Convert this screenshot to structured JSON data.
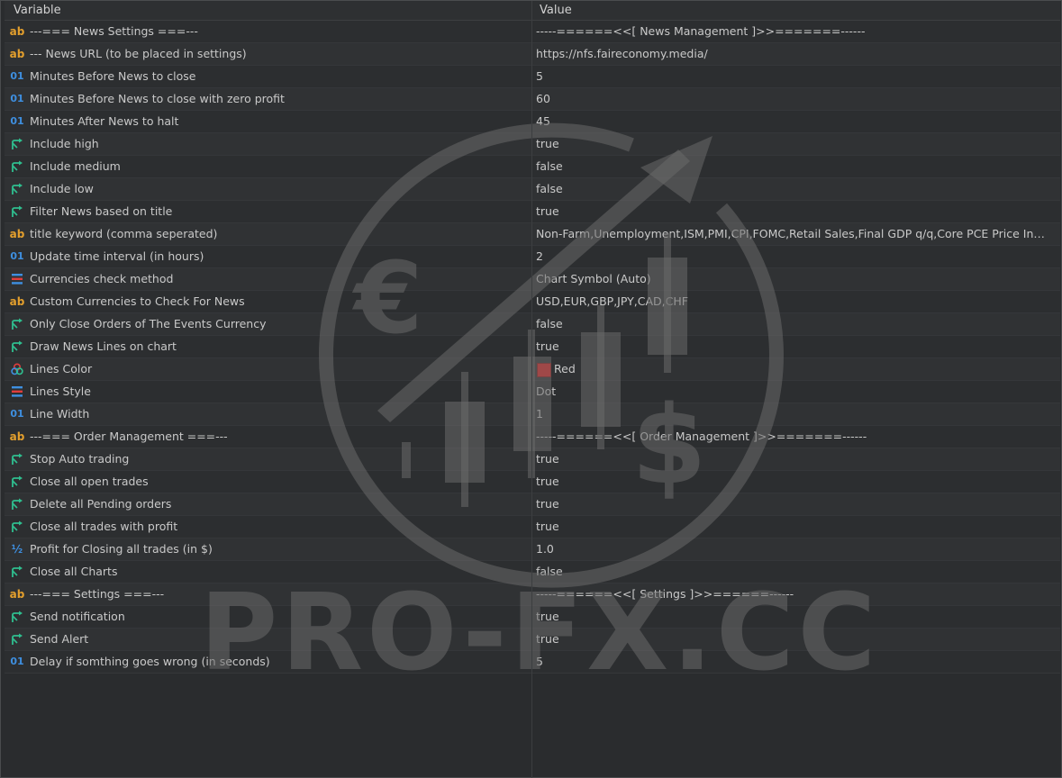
{
  "header": {
    "variable": "Variable",
    "value": "Value"
  },
  "rows": [
    {
      "icon": "ab",
      "variable": "---=== News Settings ===---",
      "value": "-----======<<[  News Management  ]>>=======------"
    },
    {
      "icon": "ab",
      "variable": "--- News URL (to be placed in settings)",
      "value": "https://nfs.faireconomy.media/"
    },
    {
      "icon": "01",
      "variable": "Minutes Before News to close",
      "value": "5"
    },
    {
      "icon": "01",
      "variable": "Minutes Before News to close with zero profit",
      "value": "60"
    },
    {
      "icon": "01",
      "variable": "Minutes After News to halt",
      "value": "45"
    },
    {
      "icon": "bool",
      "variable": "Include high",
      "value": "true"
    },
    {
      "icon": "bool",
      "variable": "Include medium",
      "value": "false"
    },
    {
      "icon": "bool",
      "variable": "Include low",
      "value": "false"
    },
    {
      "icon": "bool",
      "variable": "Filter News based on title",
      "value": "true"
    },
    {
      "icon": "ab",
      "variable": "title keyword (comma seperated)",
      "value": "Non-Farm,Unemployment,ISM,PMI,CPI,FOMC,Retail Sales,Final GDP q/q,Core PCE Price Index m/..."
    },
    {
      "icon": "01",
      "variable": "Update time interval (in hours)",
      "value": "2"
    },
    {
      "icon": "enum",
      "variable": "Currencies check method",
      "value": "Chart Symbol (Auto)"
    },
    {
      "icon": "ab",
      "variable": "Custom Currencies to Check For News",
      "value": "USD,EUR,GBP,JPY,CAD,CHF"
    },
    {
      "icon": "bool",
      "variable": "Only Close Orders of The Events Currency",
      "value": "false"
    },
    {
      "icon": "bool",
      "variable": "Draw News Lines on chart",
      "value": "true"
    },
    {
      "icon": "color",
      "variable": "Lines Color",
      "value": "Red",
      "swatch": "#e01f1f"
    },
    {
      "icon": "enum",
      "variable": "Lines Style",
      "value": "Dot"
    },
    {
      "icon": "01",
      "variable": "Line Width",
      "value": "1"
    },
    {
      "icon": "ab",
      "variable": "---=== Order Management ===---",
      "value": "-----======<<[  Order Management  ]>>=======------"
    },
    {
      "icon": "bool",
      "variable": "Stop Auto trading",
      "value": "true"
    },
    {
      "icon": "bool",
      "variable": "Close all open trades",
      "value": "true"
    },
    {
      "icon": "bool",
      "variable": "Delete all Pending orders",
      "value": "true"
    },
    {
      "icon": "bool",
      "variable": "Close all trades with profit",
      "value": "true"
    },
    {
      "icon": "frac",
      "variable": "Profit for Closing all trades (in $)",
      "value": "1.0"
    },
    {
      "icon": "bool",
      "variable": "Close all Charts",
      "value": "false"
    },
    {
      "icon": "ab",
      "variable": "---=== Settings ===---",
      "value": "-----======<<[  Settings  ]>>======------"
    },
    {
      "icon": "bool",
      "variable": "Send notification",
      "value": "true"
    },
    {
      "icon": "bool",
      "variable": "Send Alert",
      "value": "true"
    },
    {
      "icon": "01",
      "variable": "Delay if somthing goes wrong (in seconds)",
      "value": "5"
    }
  ],
  "watermark": {
    "text": "PRO-FX.CC"
  },
  "colors": {
    "string_icon": "#e39f2d",
    "number_icon": "#3e8fe0",
    "bool_icon": "#2fbf8f",
    "background": "#2a2c2e"
  }
}
